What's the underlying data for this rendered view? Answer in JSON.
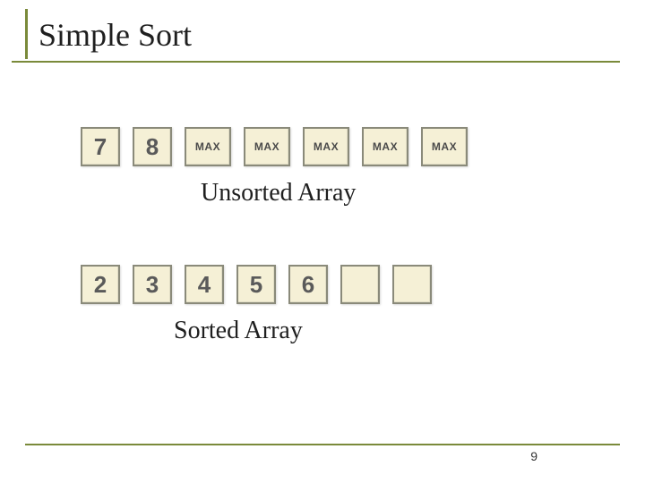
{
  "title": "Simple Sort",
  "unsorted": {
    "cells": [
      {
        "kind": "num",
        "value": "7"
      },
      {
        "kind": "num",
        "value": "8"
      },
      {
        "kind": "max",
        "value": "MAX"
      },
      {
        "kind": "max",
        "value": "MAX"
      },
      {
        "kind": "max",
        "value": "MAX"
      },
      {
        "kind": "max",
        "value": "MAX"
      },
      {
        "kind": "max",
        "value": "MAX"
      }
    ],
    "caption": "Unsorted Array"
  },
  "sorted": {
    "cells": [
      {
        "kind": "num",
        "value": "2"
      },
      {
        "kind": "num",
        "value": "3"
      },
      {
        "kind": "num",
        "value": "4"
      },
      {
        "kind": "num",
        "value": "5"
      },
      {
        "kind": "num",
        "value": "6"
      },
      {
        "kind": "empty",
        "value": ""
      },
      {
        "kind": "empty",
        "value": ""
      }
    ],
    "caption": "Sorted Array"
  },
  "page_number": "9"
}
